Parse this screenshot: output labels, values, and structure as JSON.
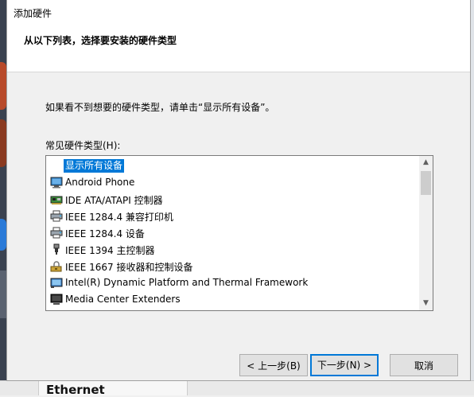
{
  "window": {
    "title": "添加硬件"
  },
  "header": {
    "instruction": "从以下列表，选择要安装的硬件类型"
  },
  "body": {
    "description": "如果看不到想要的硬件类型，请单击“显示所有设备”。",
    "list_label": "常见硬件类型(H):"
  },
  "list": {
    "items": [
      {
        "label": "显示所有设备",
        "icon": "none",
        "selected": true
      },
      {
        "label": "Android Phone",
        "icon": "monitor-icon"
      },
      {
        "label": "IDE ATA/ATAPI 控制器",
        "icon": "ide-controller-icon"
      },
      {
        "label": "IEEE 1284.4 兼容打印机",
        "icon": "printer-icon"
      },
      {
        "label": "IEEE 1284.4 设备",
        "icon": "printer-icon"
      },
      {
        "label": "IEEE 1394 主控制器",
        "icon": "usb-plug-icon"
      },
      {
        "label": "IEEE 1667 接收器和控制设备",
        "icon": "lock-device-icon"
      },
      {
        "label": "Intel(R) Dynamic Platform and Thermal Framework",
        "icon": "system-device-icon"
      },
      {
        "label": "Media Center Extenders",
        "icon": "monitor-dark-icon"
      }
    ]
  },
  "buttons": {
    "back": "< 上一步(B)",
    "next": "下一步(N) >",
    "cancel": "取消"
  },
  "background": {
    "taskbar_text": "Ethernet"
  },
  "colors": {
    "selection": "#0078d7",
    "default_button_border": "#0078d7"
  }
}
